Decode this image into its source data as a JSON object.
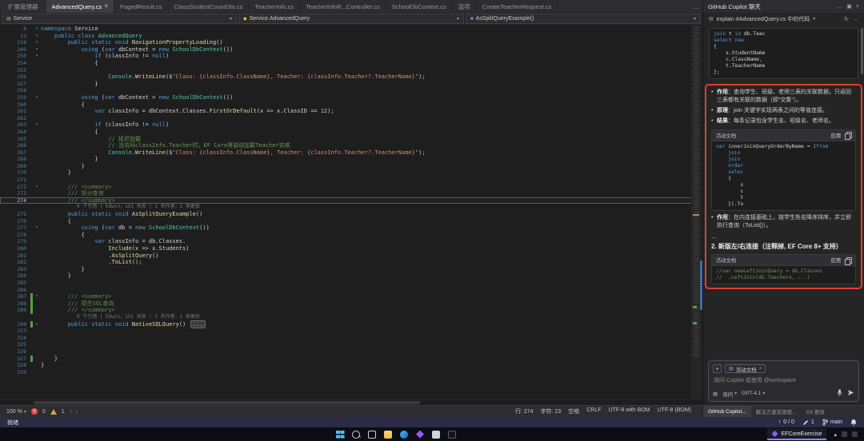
{
  "shell": {
    "tool_tab": "扩展管理器",
    "tabs": [
      {
        "label": "AdvancedQuery.cs",
        "active": true
      },
      {
        "label": "PagedResult.cs"
      },
      {
        "label": "ClassStudentCountDto.cs"
      },
      {
        "label": "TeacherInfo.cs"
      },
      {
        "label": "TeacherInfoR...Controller.cs"
      },
      {
        "label": "SchoolDbContext.cs"
      },
      {
        "label": "选项"
      },
      {
        "label": "CreateTeacherRequest.cs"
      }
    ],
    "overflow_icon": "…"
  },
  "breadcrumb": {
    "project": "Service",
    "type": "Service.AdvancedQuery",
    "member": "AsSplitQueryExample()"
  },
  "editor": {
    "lines": [
      {
        "n": "8",
        "fold": 1,
        "t": [
          [
            "k",
            "namespace"
          ],
          [
            "p",
            " Service"
          ]
        ]
      },
      {
        "n": "13",
        "fold": 1,
        "t": [
          [
            "p",
            "    "
          ],
          [
            "k",
            "public class "
          ],
          [
            "t",
            "AdvancedQuery"
          ]
        ]
      },
      {
        "n": "234",
        "fold": 1,
        "t": [
          [
            "p",
            "        "
          ],
          [
            "k",
            "public static void "
          ],
          [
            "m",
            "NavigationPropertyLoading"
          ],
          [
            "p",
            "()"
          ]
        ]
      },
      {
        "n": "246",
        "fold": 1,
        "t": [
          [
            "p",
            "            "
          ],
          [
            "k",
            "using"
          ],
          [
            "p",
            " ("
          ],
          [
            "k",
            "var"
          ],
          [
            "p",
            " dbContext = "
          ],
          [
            "k",
            "new"
          ],
          [
            "p",
            " "
          ],
          [
            "t",
            "SchoolDbContext"
          ],
          [
            "p",
            "())"
          ]
        ]
      },
      {
        "n": "250",
        "fold": 1,
        "t": [
          [
            "p",
            "                "
          ],
          [
            "k",
            "if"
          ],
          [
            "p",
            " (classInfo != "
          ],
          [
            "k",
            "null"
          ],
          [
            "p",
            ")"
          ]
        ]
      },
      {
        "n": "254",
        "t": [
          [
            "p",
            "                {"
          ]
        ]
      },
      {
        "n": "255",
        "t": []
      },
      {
        "n": "256",
        "t": [
          [
            "p",
            "                    "
          ],
          [
            "t",
            "Console"
          ],
          [
            "p",
            "."
          ],
          [
            "m",
            "WriteLine"
          ],
          [
            "p",
            "($"
          ],
          [
            "s",
            "\"Class: {classInfo.ClassName}, Teacher: {classInfo.Teacher?.TeacherName}\""
          ],
          [
            "p",
            ");"
          ]
        ]
      },
      {
        "n": "257",
        "t": [
          [
            "p",
            "                }"
          ]
        ]
      },
      {
        "n": "258",
        "t": []
      },
      {
        "n": "259",
        "fold": 1,
        "t": [
          [
            "p",
            "            "
          ],
          [
            "k",
            "using"
          ],
          [
            "p",
            " ("
          ],
          [
            "k",
            "var"
          ],
          [
            "p",
            " dbContext = "
          ],
          [
            "k",
            "new"
          ],
          [
            "p",
            " "
          ],
          [
            "t",
            "SchoolDbContext"
          ],
          [
            "p",
            "())"
          ]
        ]
      },
      {
        "n": "260",
        "t": [
          [
            "p",
            "            {"
          ]
        ]
      },
      {
        "n": "261",
        "t": [
          [
            "p",
            "                "
          ],
          [
            "k",
            "var"
          ],
          [
            "p",
            " classInfo = dbContext.Classes."
          ],
          [
            "m",
            "FirstOrDefault"
          ],
          [
            "p",
            "(x => x.ClassID == "
          ],
          [
            "num",
            "12"
          ],
          [
            "p",
            ");"
          ]
        ]
      },
      {
        "n": "262",
        "t": []
      },
      {
        "n": "263",
        "fold": 1,
        "t": [
          [
            "p",
            "                "
          ],
          [
            "k",
            "if"
          ],
          [
            "p",
            " (classInfo != "
          ],
          [
            "k",
            "null"
          ],
          [
            "p",
            ")"
          ]
        ]
      },
      {
        "n": "264",
        "t": [
          [
            "p",
            "                {"
          ]
        ]
      },
      {
        "n": "265",
        "t": [
          [
            "c",
            "                    // 延迟加载"
          ]
        ]
      },
      {
        "n": "266",
        "t": [
          [
            "c",
            "                    // 当访问classInfo.Teacher时，EF Core将自动加载Teacher实体"
          ]
        ]
      },
      {
        "n": "267",
        "t": [
          [
            "p",
            "                    "
          ],
          [
            "t",
            "Console"
          ],
          [
            "p",
            "."
          ],
          [
            "m",
            "WriteLine"
          ],
          [
            "p",
            "($"
          ],
          [
            "s",
            "\"Class: {classInfo.ClassName}, Teacher: {classInfo.Teacher?.TeacherName}\""
          ],
          [
            "p",
            ");"
          ]
        ]
      },
      {
        "n": "268",
        "t": [
          [
            "p",
            "                }"
          ]
        ]
      },
      {
        "n": "269",
        "t": [
          [
            "p",
            "            }"
          ]
        ]
      },
      {
        "n": "270",
        "t": [
          [
            "p",
            "        }"
          ]
        ]
      },
      {
        "n": "271",
        "t": []
      },
      {
        "n": "272",
        "fold": 1,
        "t": [
          [
            "d",
            "        /// <summary>"
          ]
        ]
      },
      {
        "n": "273",
        "t": [
          [
            "d",
            "        /// 拆分查询"
          ]
        ]
      },
      {
        "n": "274",
        "cur": 1,
        "t": [
          [
            "d",
            "        /// </summary>"
          ]
        ]
      },
      {
        "lens": "0 个引用 | Edwin，151 天前 | 1 名作者，1 项更改"
      },
      {
        "n": "275",
        "t": [
          [
            "p",
            "        "
          ],
          [
            "k",
            "public static void "
          ],
          [
            "m",
            "AsSplitQueryExample"
          ],
          [
            "p",
            "()"
          ]
        ]
      },
      {
        "n": "276",
        "t": [
          [
            "p",
            "        {"
          ]
        ]
      },
      {
        "n": "277",
        "fold": 1,
        "t": [
          [
            "p",
            "            "
          ],
          [
            "k",
            "using"
          ],
          [
            "p",
            " ("
          ],
          [
            "k",
            "var"
          ],
          [
            "p",
            " db = "
          ],
          [
            "k",
            "new"
          ],
          [
            "p",
            " "
          ],
          [
            "t",
            "SchoolDbContext"
          ],
          [
            "p",
            "())"
          ]
        ]
      },
      {
        "n": "278",
        "t": [
          [
            "p",
            "            {"
          ]
        ]
      },
      {
        "n": "279",
        "t": [
          [
            "p",
            "                "
          ],
          [
            "k",
            "var"
          ],
          [
            "p",
            " classInfo = db.Classes."
          ]
        ]
      },
      {
        "n": "280",
        "t": [
          [
            "p",
            "                    "
          ],
          [
            "m",
            "Include"
          ],
          [
            "p",
            "(x => x.Students)"
          ]
        ]
      },
      {
        "n": "281",
        "t": [
          [
            "p",
            "                    ."
          ],
          [
            "m",
            "AsSplitQuery"
          ],
          [
            "p",
            "()"
          ]
        ]
      },
      {
        "n": "282",
        "t": [
          [
            "p",
            "                    ."
          ],
          [
            "m",
            "ToList"
          ],
          [
            "p",
            "();"
          ]
        ]
      },
      {
        "n": "283",
        "t": [
          [
            "p",
            "            }"
          ]
        ]
      },
      {
        "n": "284",
        "t": [
          [
            "p",
            "        }"
          ]
        ]
      },
      {
        "n": "285",
        "t": []
      },
      {
        "n": "286",
        "t": []
      },
      {
        "n": "287",
        "fold": 1,
        "green": 1,
        "t": [
          [
            "d",
            "        /// <summary>"
          ]
        ]
      },
      {
        "n": "288",
        "green": 1,
        "t": [
          [
            "d",
            "        /// 原生SQL查询"
          ]
        ]
      },
      {
        "n": "289",
        "green": 1,
        "t": [
          [
            "d",
            "        /// </summary>"
          ]
        ]
      },
      {
        "lens": "0 个引用 | Edwin，151 天前 | 1 名作者，1 项更改"
      },
      {
        "n": "290",
        "fold": 2,
        "green": 1,
        "t": [
          [
            "p",
            "        "
          ],
          [
            "k",
            "public static void "
          ],
          [
            "m",
            "NativeSQLQuery"
          ],
          [
            "p",
            "() "
          ],
          [
            "box",
            "..."
          ]
        ]
      },
      {
        "n": "323",
        "t": []
      },
      {
        "n": "324",
        "t": []
      },
      {
        "n": "325",
        "t": []
      },
      {
        "n": "326",
        "t": []
      },
      {
        "n": "327",
        "green": 1,
        "t": [
          [
            "p",
            "    }"
          ]
        ]
      },
      {
        "n": "328",
        "t": [
          [
            "p",
            "}"
          ]
        ]
      },
      {
        "n": "329",
        "t": []
      }
    ]
  },
  "copilot": {
    "title": "GitHub Copilot 聊天",
    "prompt": "explain #AdvancedQuery.cs 中的代码",
    "code1": [
      [
        [
          "k",
          "join"
        ],
        [
          "p",
          " t "
        ],
        [
          "k",
          "in"
        ],
        [
          "p",
          " db.Teac"
        ]
      ],
      [
        [
          "k",
          "select"
        ],
        [
          "p",
          " "
        ],
        [
          "k",
          "new"
        ]
      ],
      [
        [
          "p",
          "{"
        ]
      ],
      [
        [
          "p",
          "    s.StudentName"
        ]
      ],
      [
        [
          "p",
          "    c.ClassName,"
        ]
      ],
      [
        [
          "p",
          "    t.TeacherName"
        ]
      ],
      [
        [
          "p",
          "};"
        ]
      ]
    ],
    "bullets1": [
      {
        "b": "作用",
        "t": "：查询学生、班级、老师三表的关联数据，只返回三表都有关联的数据（即“交集”）。"
      },
      {
        "b": "原理",
        "t": "：join 关键字实现两表之间的等值连接。"
      },
      {
        "b": "结果",
        "t": "：每条记录包含学生名、班级名、老师名。"
      }
    ],
    "doc_label": "活动文档",
    "apply_label": "应用",
    "code2": [
      [
        [
          "k",
          "var"
        ],
        [
          "p",
          " innerJoinQueryOrderByName = ("
        ],
        [
          "k",
          "from"
        ]
      ],
      [
        [
          "p",
          "    "
        ],
        [
          "k",
          "join"
        ]
      ],
      [
        [
          "p",
          "    "
        ],
        [
          "k",
          "join"
        ]
      ],
      [
        [
          "p",
          "    "
        ],
        [
          "k",
          "order"
        ]
      ],
      [
        [
          "p",
          "    "
        ],
        [
          "k",
          "selec"
        ]
      ],
      [
        [
          "p",
          "    {"
        ]
      ],
      [
        [
          "p",
          "        s"
        ]
      ],
      [
        [
          "p",
          "        c"
        ]
      ],
      [
        [
          "p",
          "        t"
        ]
      ],
      [
        [
          "p",
          "    }).To"
        ]
      ]
    ],
    "bullets2": [
      {
        "b": "作用",
        "t": "：在内连接基础上，按学生姓名降序排序，并立即执行查询（ToList()）。"
      }
    ],
    "ellipsis": "...",
    "heading2": "2. 新版左/右连接（注释掉, EF Core 8+ 支持）",
    "code3": [
      [
        [
          "c",
          "//var newLeftJoinQuery = db.Classes"
        ]
      ],
      [
        [
          "c",
          "//  .LeftJoin(db.Teachers, ...)"
        ]
      ]
    ],
    "chat": {
      "add": "+",
      "chip": "活动文档",
      "chip_close": "×",
      "placeholder": "询问 Copilot 或使用 @workspace",
      "mode": "询问",
      "model": "GPT-4.1"
    },
    "panel_tabs": [
      {
        "label": "GitHub Copilot...",
        "active": true
      },
      {
        "label": "解决方案资源管..."
      },
      {
        "label": "Git 更改"
      }
    ]
  },
  "status_strip": {
    "zoom": "100 %",
    "errors": "0",
    "warnings": "1",
    "doc_info": [
      "行: 274",
      "字符: 23",
      "空格",
      "CRLF",
      "UTF-8 with BOM",
      "UTF-8 (BOM)"
    ]
  },
  "statusbar": {
    "ready": "就绪",
    "sync": "0 / 0",
    "edits": "1",
    "branch": "main"
  },
  "taskbar": {
    "icons": [
      "start",
      "search",
      "task-view",
      "file-explorer",
      "edge",
      "visual-studio",
      "database",
      "terminal"
    ],
    "window_label": "EFCoreExercise",
    "tray": [
      "chevron-up",
      "network",
      "volume"
    ]
  }
}
